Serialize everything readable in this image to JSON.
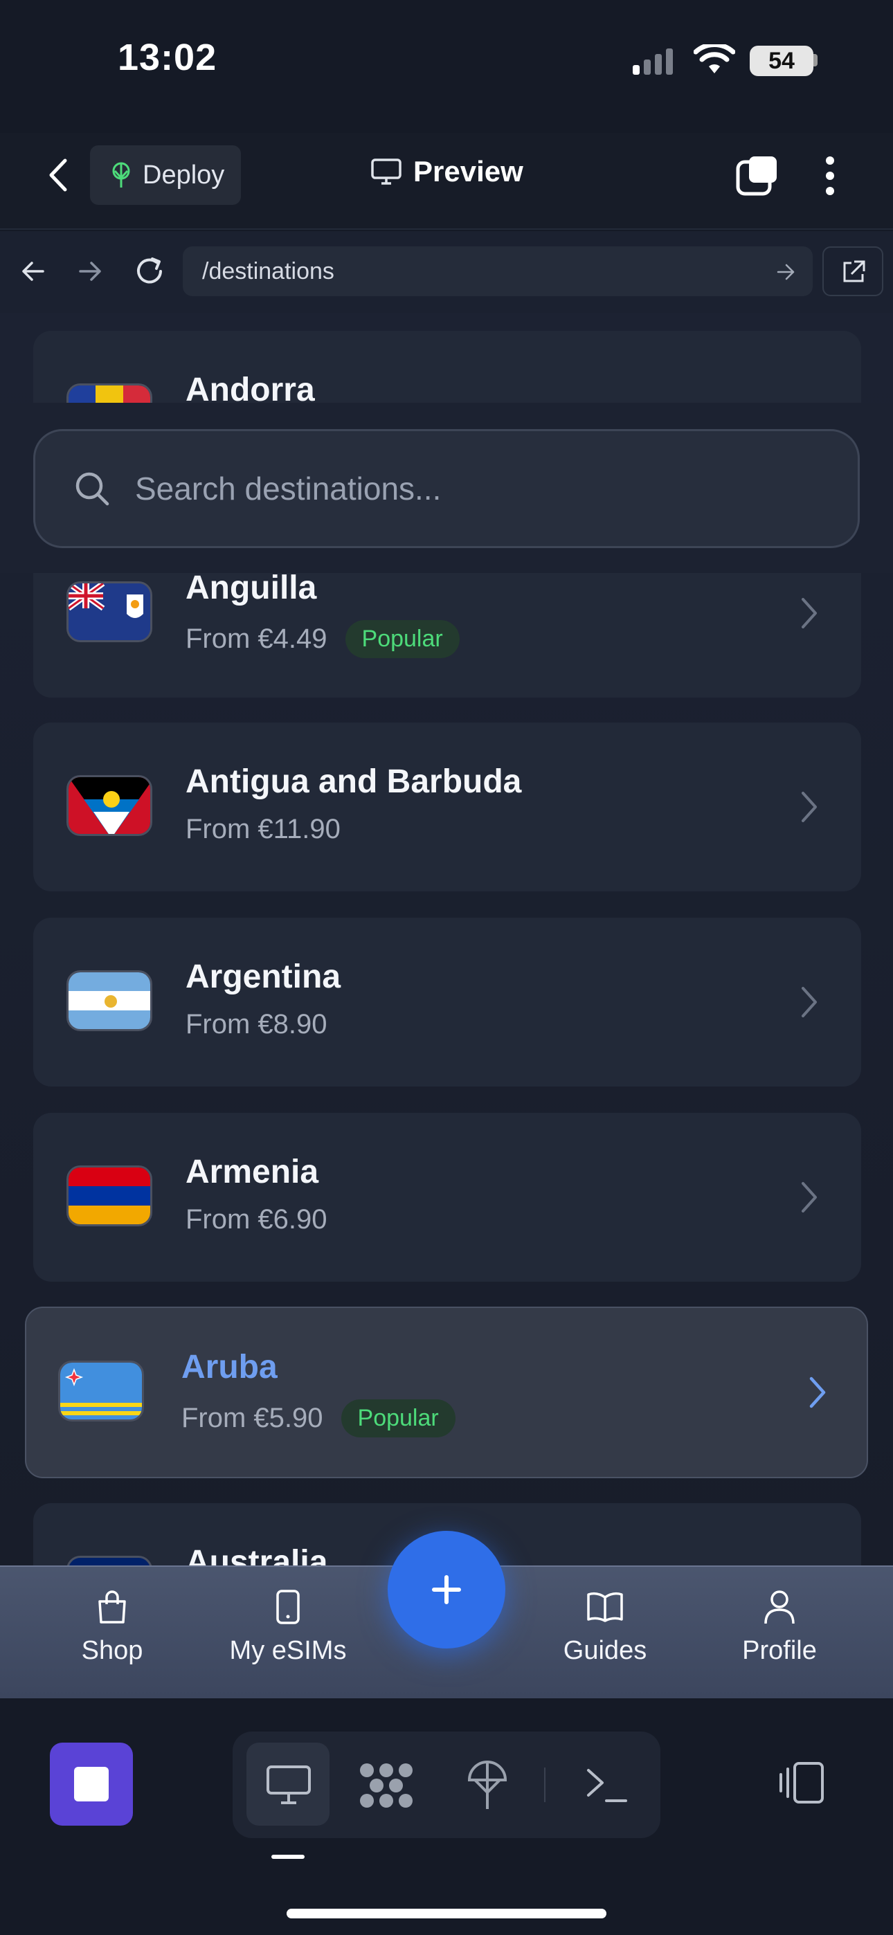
{
  "status_bar": {
    "time": "13:02",
    "battery": "54"
  },
  "toolbar": {
    "deploy_label": "Deploy",
    "preview_label": "Preview"
  },
  "browser": {
    "url": "/destinations"
  },
  "search": {
    "placeholder": "Search destinations..."
  },
  "destinations": [
    {
      "name": "Andorra",
      "price": "",
      "badge": ""
    },
    {
      "name": "Anguilla",
      "price": "From €4.49",
      "badge": "Popular"
    },
    {
      "name": "Antigua and Barbuda",
      "price": "From €11.90",
      "badge": ""
    },
    {
      "name": "Argentina",
      "price": "From €8.90",
      "badge": ""
    },
    {
      "name": "Armenia",
      "price": "From €6.90",
      "badge": ""
    },
    {
      "name": "Aruba",
      "price": "From €5.90",
      "badge": "Popular"
    },
    {
      "name": "Australia",
      "price": "",
      "badge": ""
    }
  ],
  "tabbar": {
    "shop": "Shop",
    "my_esims": "My eSIMs",
    "guides": "Guides",
    "profile": "Profile"
  },
  "colors": {
    "accent": "#2f6ee8",
    "popular_badge": "#4ddb7a",
    "highlight_name": "#6f9ef0",
    "stop_button": "#5a43d6"
  }
}
